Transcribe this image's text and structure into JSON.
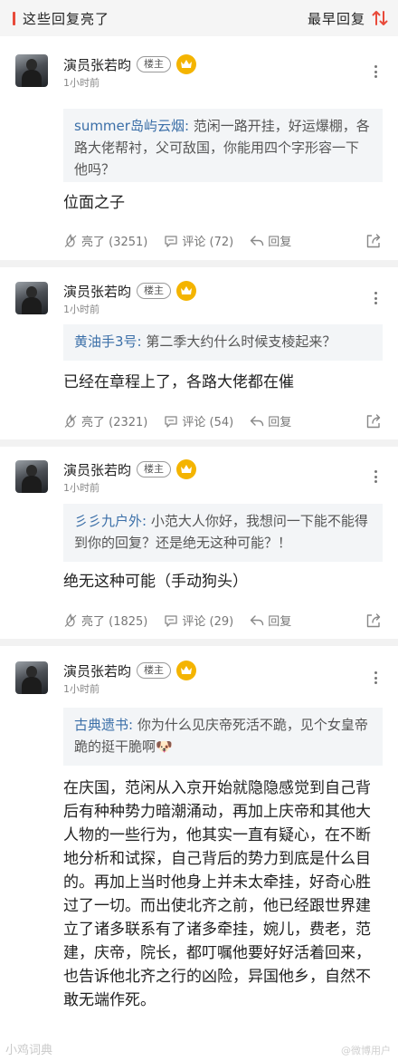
{
  "header": {
    "title": "这些回复亮了",
    "sort_label": "最早回复",
    "accent_color": "#e84a3a"
  },
  "comments": [
    {
      "user": "演员张若昀",
      "badge": "楼主",
      "time": "1小时前",
      "quote_author": "summer岛屿云烟:",
      "quote_text": " 范闲一路开挂，好运爆棚，各路大佬帮衬，父可敌国，你能用四个字形容一下他吗？",
      "reply": "位面之子",
      "likes": "亮了 (3251)",
      "comments": "评论 (72)",
      "reply_label": "回复"
    },
    {
      "user": "演员张若昀",
      "badge": "楼主",
      "time": "1小时前",
      "quote_author": "黄油手3号:",
      "quote_text": " 第二季大约什么时候支棱起来？",
      "reply": "已经在章程上了，各路大佬都在催",
      "likes": "亮了 (2321)",
      "comments": "评论 (54)",
      "reply_label": "回复"
    },
    {
      "user": "演员张若昀",
      "badge": "楼主",
      "time": "1小时前",
      "quote_author": "彡彡九户外:",
      "quote_text": " 小范大人你好，我想问一下能不能得到你的回复？还是绝无这种可能？！",
      "reply": "绝无这种可能（手动狗头）",
      "likes": "亮了 (1825)",
      "comments": "评论 (29)",
      "reply_label": "回复"
    },
    {
      "user": "演员张若昀",
      "badge": "楼主",
      "time": "1小时前",
      "quote_author": "古典遗书:",
      "quote_text": " 你为什么见庆帝死活不跪，见个女皇帝跪的挺干脆啊",
      "quote_emoji": "🐶",
      "reply": "在庆国，范闲从入京开始就隐隐感觉到自己背后有种种势力暗潮涌动，再加上庆帝和其他大人物的一些行为，他其实一直有疑心，在不断地分析和试探，自己背后的势力到底是什么目的。再加上当时他身上并未太牵挂，好奇心胜过了一切。而出使北齐之前，他已经跟世界建立了诸多联系有了诸多牵挂，婉儿，费老，范建，庆帝，院长，都叮嘱他要好好活着回来，也告诉他北齐之行的凶险，异国他乡，自然不敢无端作死。"
    }
  ],
  "watermark": {
    "left": "小鸡词典",
    "right": "@微博用户"
  }
}
